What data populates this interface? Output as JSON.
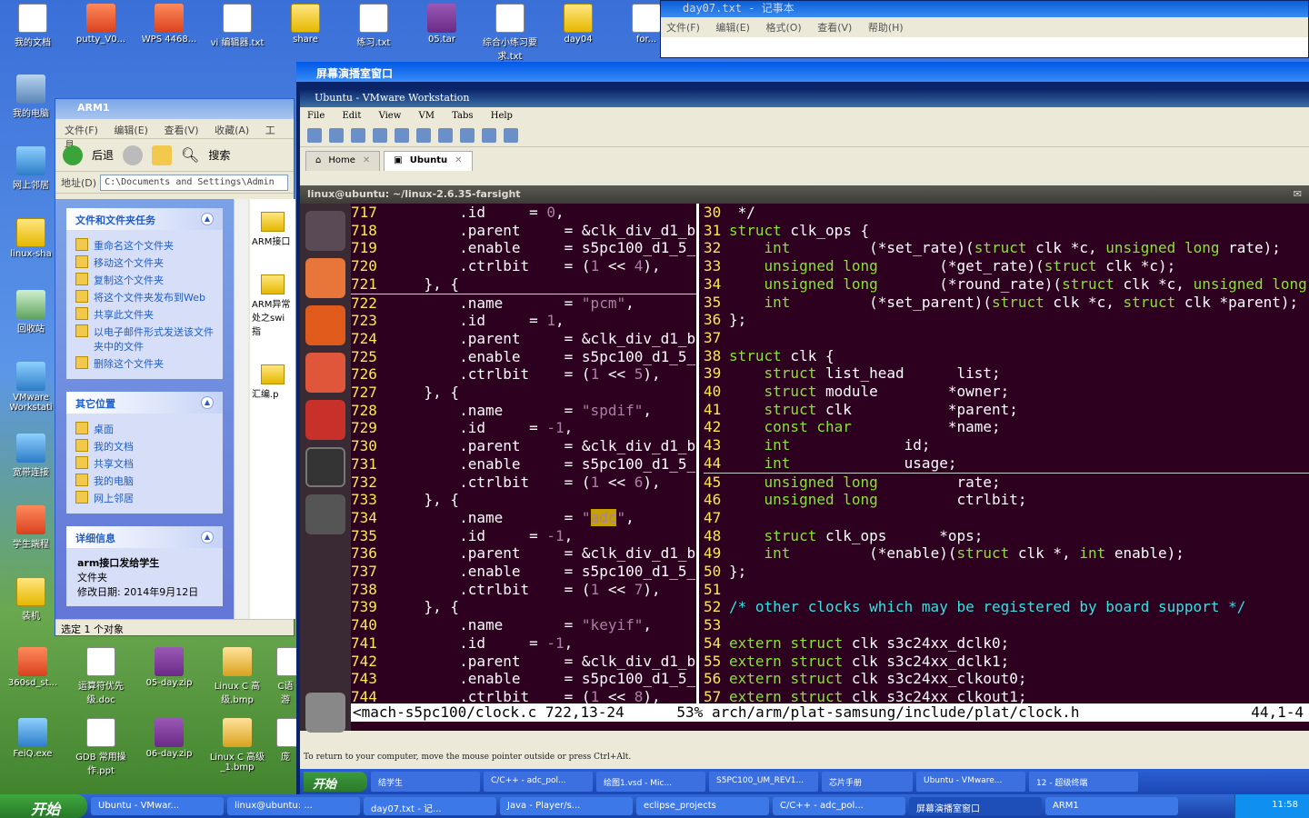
{
  "desktop": {
    "top_icons": [
      "我的文档",
      "putty_V0...",
      "WPS 4468...",
      "vi 编辑器.txt",
      "share",
      "练习.txt",
      "05.tar",
      "综合小练习要求.txt",
      "day04",
      "for..."
    ],
    "left_icons": [
      "我的电脑",
      "网上邻居",
      "linux-sha",
      "回收站",
      "VMware Workstati",
      "宽带连接",
      "学生端程",
      "装机"
    ],
    "bottom_icons": [
      "360sd_st...",
      "运算符优先级.doc",
      "05-day.zip",
      "Linux C 高级.bmp",
      "C语游",
      "FeiQ.exe",
      "GDB 常用操作.ppt",
      "06-day.zip",
      "Linux C 高级_1.bmp",
      "庞"
    ]
  },
  "notepad": {
    "title": "day07.txt - 记事本",
    "menu": [
      "文件(F)",
      "编辑(E)",
      "格式(O)",
      "查看(V)",
      "帮助(H)"
    ]
  },
  "explorer": {
    "title": "ARM1",
    "menu": [
      "文件(F)",
      "编辑(E)",
      "查看(V)",
      "收藏(A)",
      "工具"
    ],
    "back_label": "后退",
    "search_label": "搜索",
    "address_label": "地址(D)",
    "address_value": "C:\\Documents and Settings\\Admin",
    "tasks_header": "文件和文件夹任务",
    "tasks": [
      "重命名这个文件夹",
      "移动这个文件夹",
      "复制这个文件夹",
      "将这个文件夹发布到Web",
      "共享此文件夹",
      "以电子邮件形式发送该文件夹中的文件",
      "删除这个文件夹"
    ],
    "places_header": "其它位置",
    "places": [
      "桌面",
      "我的文档",
      "共享文档",
      "我的电脑",
      "网上邻居"
    ],
    "details_header": "详细信息",
    "details_name": "arm接口发给学生",
    "details_type": "文件夹",
    "details_date": "修改日期: 2014年9月12日",
    "files": [
      "ARM接口",
      "ARM异常处之swi指",
      "汇编.p"
    ],
    "status": "选定 1 个对象"
  },
  "broadcast": {
    "title": "屏幕演播室窗口"
  },
  "vmware": {
    "title": "Ubuntu - VMware Workstation",
    "menu": [
      "File",
      "Edit",
      "View",
      "VM",
      "Tabs",
      "Help"
    ],
    "tabs": [
      {
        "label": "Home"
      },
      {
        "label": "Ubuntu"
      }
    ],
    "guest_title": "linux@ubuntu: ~/linux-2.6.35-farsight",
    "status_hint": "To return to your computer, move the mouse pointer outside or press Ctrl+Alt.",
    "inner_tasks": [
      "结学生",
      "C/C++ - adc_pol...",
      "绘图1.vsd - Mic...",
      "S5PC100_UM_REV1...",
      "芯片手册",
      "Ubuntu - VMware...",
      "12 - 超级终端"
    ],
    "inner_start": "开始"
  },
  "vim": {
    "left_lines": [
      [
        "717",
        "        .id     = 0,"
      ],
      [
        "718",
        "        .parent     = &clk_div_d1_b"
      ],
      [
        "719",
        "        .enable     = s5pc100_d1_5_"
      ],
      [
        "720",
        "        .ctrlbit    = (1 << 4),"
      ],
      [
        "721",
        "    }, {"
      ],
      [
        "722",
        "        .name       = \"pcm\","
      ],
      [
        "723",
        "        .id     = 1,"
      ],
      [
        "724",
        "        .parent     = &clk_div_d1_b"
      ],
      [
        "725",
        "        .enable     = s5pc100_d1_5_"
      ],
      [
        "726",
        "        .ctrlbit    = (1 << 5),"
      ],
      [
        "727",
        "    }, {"
      ],
      [
        "728",
        "        .name       = \"spdif\","
      ],
      [
        "729",
        "        .id     = -1,"
      ],
      [
        "730",
        "        .parent     = &clk_div_d1_b"
      ],
      [
        "731",
        "        .enable     = s5pc100_d1_5_"
      ],
      [
        "732",
        "        .ctrlbit    = (1 << 6),"
      ],
      [
        "733",
        "    }, {"
      ],
      [
        "734",
        "        .name       = \"adc\","
      ],
      [
        "735",
        "        .id     = -1,"
      ],
      [
        "736",
        "        .parent     = &clk_div_d1_b"
      ],
      [
        "737",
        "        .enable     = s5pc100_d1_5_"
      ],
      [
        "738",
        "        .ctrlbit    = (1 << 7),"
      ],
      [
        "739",
        "    }, {"
      ],
      [
        "740",
        "        .name       = \"keyif\","
      ],
      [
        "741",
        "        .id     = -1,"
      ],
      [
        "742",
        "        .parent     = &clk_div_d1_b"
      ],
      [
        "743",
        "        .enable     = s5pc100_d1_5_"
      ],
      [
        "744",
        "        .ctrlbit    = (1 << 8),"
      ]
    ],
    "right_lines": [
      [
        "30",
        " */"
      ],
      [
        "31",
        "struct clk_ops {"
      ],
      [
        "32",
        "    int         (*set_rate)(struct clk *c, unsigned long rate);"
      ],
      [
        "33",
        "    unsigned long       (*get_rate)(struct clk *c);"
      ],
      [
        "34",
        "    unsigned long       (*round_rate)(struct clk *c, unsigned long"
      ],
      [
        "35",
        "    int         (*set_parent)(struct clk *c, struct clk *parent);"
      ],
      [
        "36",
        "};"
      ],
      [
        "37",
        ""
      ],
      [
        "38",
        "struct clk {"
      ],
      [
        "39",
        "    struct list_head      list;"
      ],
      [
        "40",
        "    struct module        *owner;"
      ],
      [
        "41",
        "    struct clk           *parent;"
      ],
      [
        "42",
        "    const char           *name;"
      ],
      [
        "43",
        "    int             id;"
      ],
      [
        "44",
        "    int             usage;"
      ],
      [
        "45",
        "    unsigned long         rate;"
      ],
      [
        "46",
        "    unsigned long         ctrlbit;"
      ],
      [
        "47",
        ""
      ],
      [
        "48",
        "    struct clk_ops      *ops;"
      ],
      [
        "49",
        "    int         (*enable)(struct clk *, int enable);"
      ],
      [
        "50",
        "};"
      ],
      [
        "51",
        ""
      ],
      [
        "52",
        "/* other clocks which may be registered by board support */"
      ],
      [
        "53",
        ""
      ],
      [
        "54",
        "extern struct clk s3c24xx_dclk0;"
      ],
      [
        "55",
        "extern struct clk s3c24xx_dclk1;"
      ],
      [
        "56",
        "extern struct clk s3c24xx_clkout0;"
      ],
      [
        "57",
        "extern struct clk s3c24xx_clkout1;"
      ]
    ],
    "status_left": "<mach-s5pc100/clock.c 722,13-24      53%",
    "status_right": "arch/arm/plat-samsung/include/plat/clock.h",
    "status_pos": "44,1-4"
  },
  "taskbar": {
    "start": "开始",
    "tasks": [
      "Ubuntu - VMwar...",
      "linux@ubuntu: ...",
      "day07.txt - 记...",
      "Java - Player/s...",
      "eclipse_projects",
      "C/C++ - adc_pol...",
      "屏幕演播室窗口",
      "ARM1"
    ],
    "clock": "11:58"
  }
}
